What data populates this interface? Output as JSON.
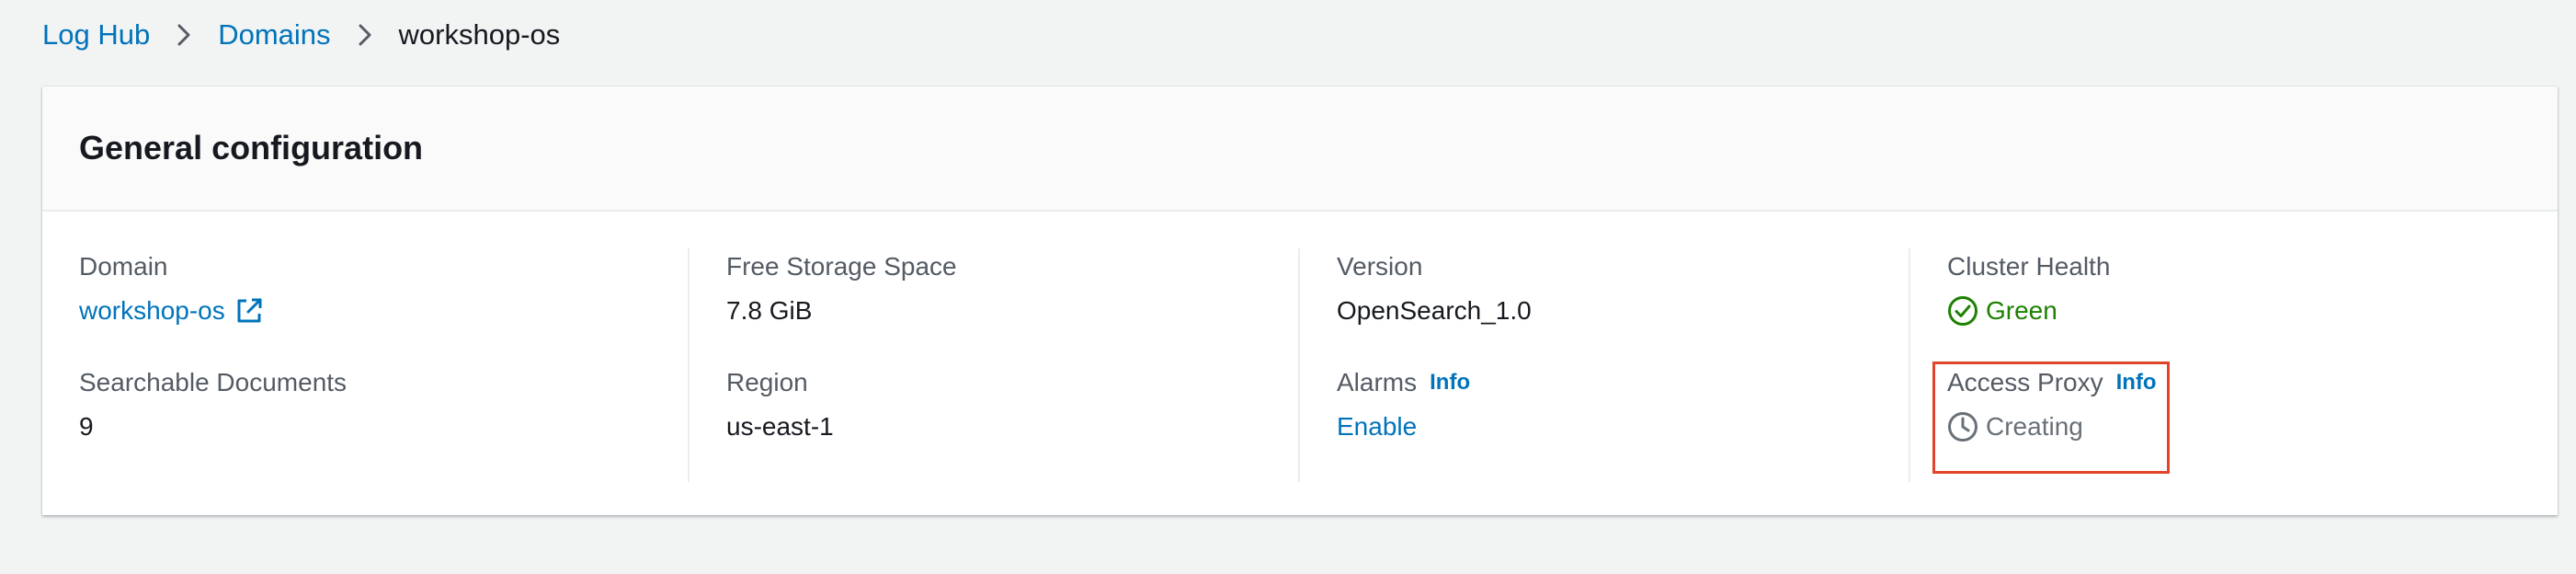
{
  "breadcrumb": {
    "items": [
      {
        "label": "Log Hub"
      },
      {
        "label": "Domains"
      }
    ],
    "current": "workshop-os"
  },
  "panel": {
    "title": "General configuration",
    "fields": {
      "domain": {
        "label": "Domain",
        "value": "workshop-os",
        "icon": "external-link-icon"
      },
      "searchable_documents": {
        "label": "Searchable Documents",
        "value": "9"
      },
      "free_storage": {
        "label": "Free Storage Space",
        "value": "7.8 GiB"
      },
      "region": {
        "label": "Region",
        "value": "us-east-1"
      },
      "version": {
        "label": "Version",
        "value": "OpenSearch_1.0"
      },
      "alarms": {
        "label": "Alarms",
        "info": "Info",
        "value": "Enable"
      },
      "cluster_health": {
        "label": "Cluster Health",
        "value": "Green",
        "icon": "check-circle-icon",
        "color": "#1d8102"
      },
      "access_proxy": {
        "label": "Access Proxy",
        "info": "Info",
        "value": "Creating",
        "icon": "clock-icon",
        "color": "#687078"
      }
    }
  },
  "colors": {
    "link": "#0073bb",
    "highlight": "#e0442b",
    "background": "#f2f3f3"
  }
}
